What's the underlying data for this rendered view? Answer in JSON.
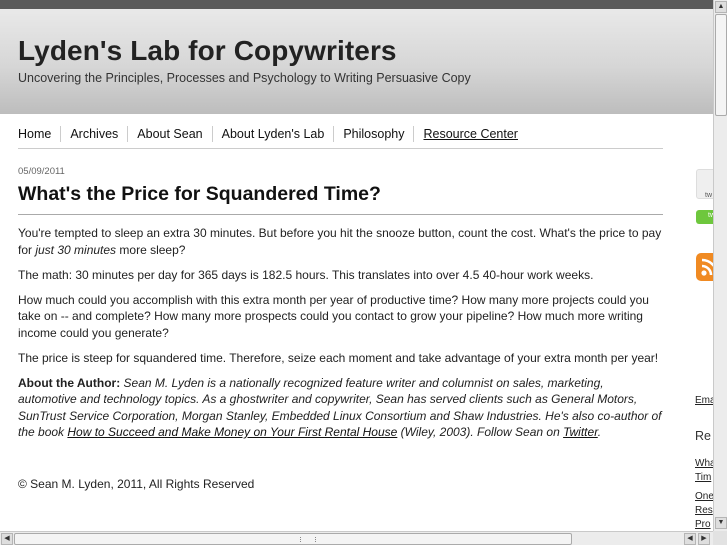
{
  "site": {
    "title": "Lyden's Lab for Copywriters",
    "tagline": "Uncovering the Principles, Processes and Psychology to Writing Persuasive Copy"
  },
  "nav": {
    "items": [
      "Home",
      "Archives",
      "About Sean",
      "About Lyden's Lab",
      "Philosophy",
      "Resource Center"
    ]
  },
  "post": {
    "date": "05/09/2011",
    "title": "What's the Price for Squandered Time?",
    "p1_a": "You're tempted to sleep an extra 30 minutes. But before you hit the snooze button, count the cost. What's the price to pay for ",
    "p1_em": "just 30 minutes",
    "p1_b": " more sleep?",
    "p2": "The math: 30 minutes per day for 365 days is 182.5 hours. This translates into over 4.5 40-hour work weeks.",
    "p3": "How much could you accomplish with this extra month per year of productive time? How many more projects could you take on -- and complete? How many more prospects could you contact to grow your pipeline? How much more writing income could you generate?",
    "p4": "The price is steep for squandered time. Therefore, seize each moment and take advantage of your extra month per year!",
    "bio_label": "About the Author:",
    "bio_text": " Sean M. Lyden is a nationally recognized feature writer and columnist on sales, marketing, automotive and technology topics. As a ghostwriter and copywriter, Sean has served clients such as General Motors, SunTrust Service Corporation, Morgan Stanley, Embedded Linux Consortium and Shaw Industries. He's also co-author of the book ",
    "bio_book": "How to Succeed and Make Money on Your First Rental House",
    "bio_after_book": " (Wiley, 2003). Follow Sean on ",
    "bio_twitter": "Twitter",
    "bio_end": "."
  },
  "footer": {
    "copyright": "© Sean M. Lyden, 2011, All Rights Reserved"
  },
  "sidebar": {
    "tw_box": "tw",
    "tw_green": "tw",
    "link_email": "Ema",
    "heading": "Re",
    "link_1a": "Wha",
    "link_1b": "Tim",
    "link_2a": "One",
    "link_2b": "Res",
    "link_2c": "Pro"
  },
  "colors": {
    "header_light": "#e9e9e9",
    "header_dark": "#bdbdbd",
    "rss_orange": "#f08a22",
    "twitter_green": "#6ec73d"
  },
  "icons": {
    "rss": "rss-feed-icon",
    "scroll_up": "arrow-up-icon",
    "scroll_down": "arrow-down-icon",
    "scroll_left": "arrow-left-icon",
    "scroll_right": "arrow-right-icon"
  }
}
